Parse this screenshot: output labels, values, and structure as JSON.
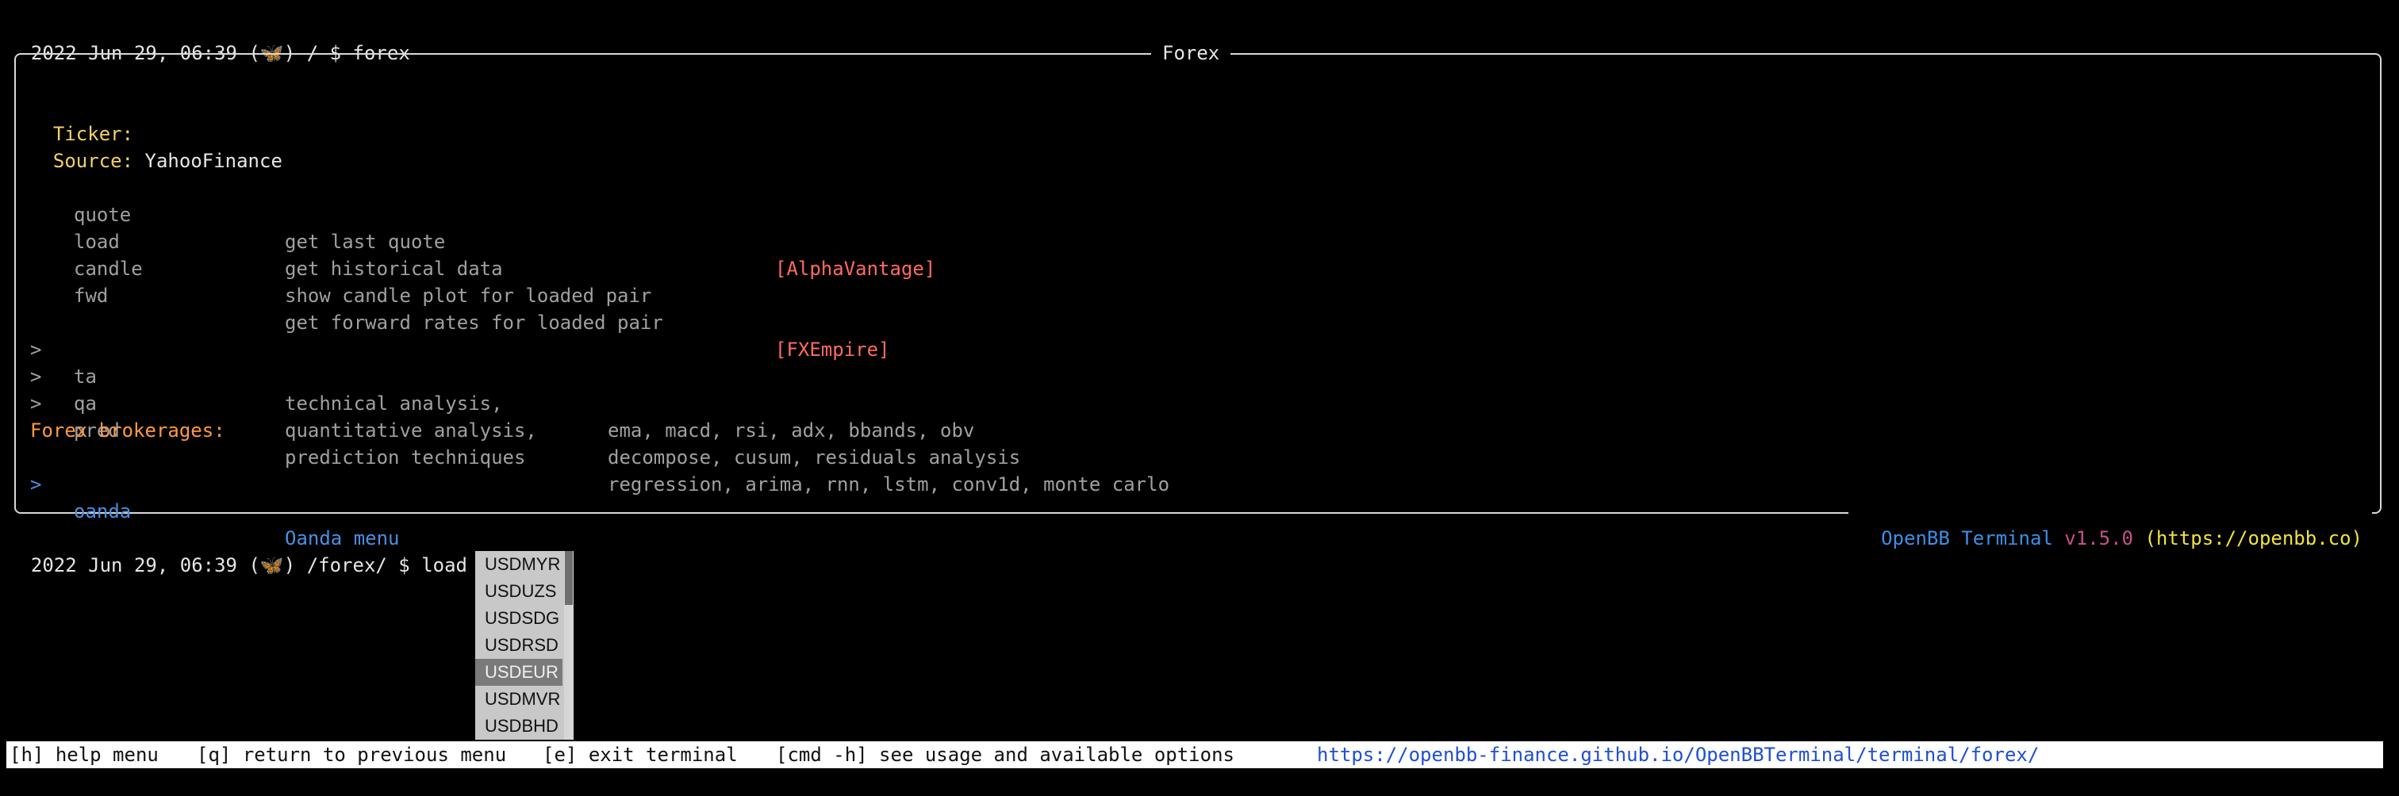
{
  "prompt1": {
    "timestamp": "2022 Jun 29, 06:39",
    "icon": "butterfly-icon",
    "path": "/ $",
    "command": "forex"
  },
  "panel": {
    "title": "Forex",
    "ticker_label": "Ticker:",
    "ticker_value": "",
    "source_label": "Source:",
    "source_value": "YahooFinance",
    "commands": [
      {
        "name": "quote",
        "desc": "get last quote",
        "source": "[AlphaVantage]"
      },
      {
        "name": "load",
        "desc": "get historical data",
        "source": ""
      },
      {
        "name": "candle",
        "desc": "show candle plot for loaded pair",
        "source": ""
      },
      {
        "name": "fwd",
        "desc": "get forward rates for loaded pair",
        "source": "[FXEmpire]"
      }
    ],
    "menus": [
      {
        "arrow": ">",
        "name": "ta",
        "desc": "technical analysis,",
        "detail": "ema, macd, rsi, adx, bbands, obv"
      },
      {
        "arrow": ">",
        "name": "qa",
        "desc": "quantitative analysis,",
        "detail": "decompose, cusum, residuals analysis"
      },
      {
        "arrow": ">",
        "name": "pred",
        "desc": "prediction techniques",
        "detail": "regression, arima, rnn, lstm, conv1d, monte carlo"
      }
    ],
    "brokerages_label": "Forex brokerages:",
    "brokerages": [
      {
        "arrow": ">",
        "name": "oanda",
        "desc": "Oanda menu"
      }
    ],
    "footer": {
      "openbb": "OpenBB",
      "terminal": "Terminal",
      "version": "v1.5.0",
      "url": "(https://openbb.co)"
    }
  },
  "prompt2": {
    "timestamp": "2022 Jun 29, 06:39",
    "icon": "butterfly-icon",
    "path": "/forex/ $",
    "input": "load USDEUR"
  },
  "autocomplete": {
    "items": [
      "USDMYR",
      "USDUZS",
      "USDSDG",
      "USDRSD",
      "USDEUR",
      "USDMVR",
      "USDBHD"
    ],
    "selected": "USDEUR"
  },
  "bottom_bar": {
    "help_key": "[h]",
    "help_label": "help menu",
    "back_key": "[q]",
    "back_label": "return to previous menu",
    "exit_key": "[e]",
    "exit_label": "exit terminal",
    "usage_key": "[cmd -h]",
    "usage_label": "see usage and available options",
    "docs_link": "https://openbb-finance.github.io/OpenBBTerminal/terminal/forex/"
  },
  "colors": {
    "background": "#000000",
    "label_yellow": "#f2d16b",
    "brokerage_orange": "#ff9944",
    "source_red": "#ff6b5e",
    "dim_grey": "#a0a0a0",
    "link_blue": "#4a90e2"
  }
}
